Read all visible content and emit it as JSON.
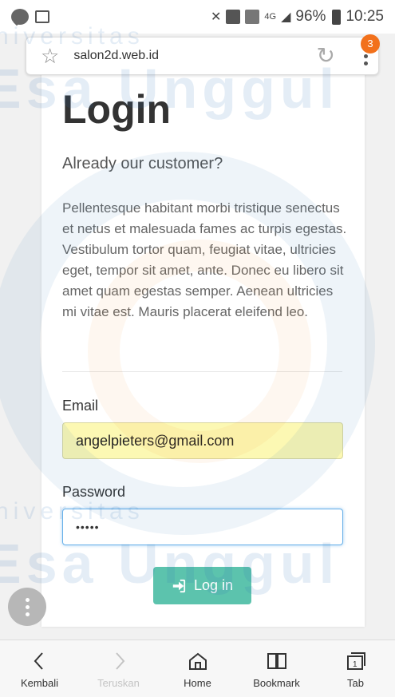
{
  "status_bar": {
    "battery": "96%",
    "time": "10:25",
    "network": "4G"
  },
  "browser": {
    "url": "salon2d.web.id",
    "notification_count": "3"
  },
  "page": {
    "title": "Login",
    "subtitle": "Already our customer?",
    "description": "Pellentesque habitant morbi tristique senectus et netus et malesuada fames ac turpis egestas. Vestibulum tortor quam, feugiat vitae, ultricies eget, tempor sit amet, ante. Donec eu libero sit amet quam egestas semper. Aenean ultricies mi vitae est. Mauris placerat eleifend leo.",
    "email_label": "Email",
    "email_value": "angelpieters@gmail.com",
    "password_label": "Password",
    "password_value": "•••••",
    "login_button": "Log in"
  },
  "watermark": {
    "line1": "niversitas",
    "line2": "Esa Unggul"
  },
  "bottom_nav": {
    "items": [
      {
        "label": "Kembali",
        "icon": "chevron-left-icon"
      },
      {
        "label": "Teruskan",
        "icon": "chevron-right-icon"
      },
      {
        "label": "Home",
        "icon": "home-icon"
      },
      {
        "label": "Bookmark",
        "icon": "bookmark-icon"
      },
      {
        "label": "Tab",
        "icon": "tab-icon"
      }
    ]
  },
  "colors": {
    "accent_button": "#5cc3ad",
    "autofill_bg": "#fcf8b3",
    "focus_border": "#66afe9",
    "badge": "#f2711c"
  }
}
